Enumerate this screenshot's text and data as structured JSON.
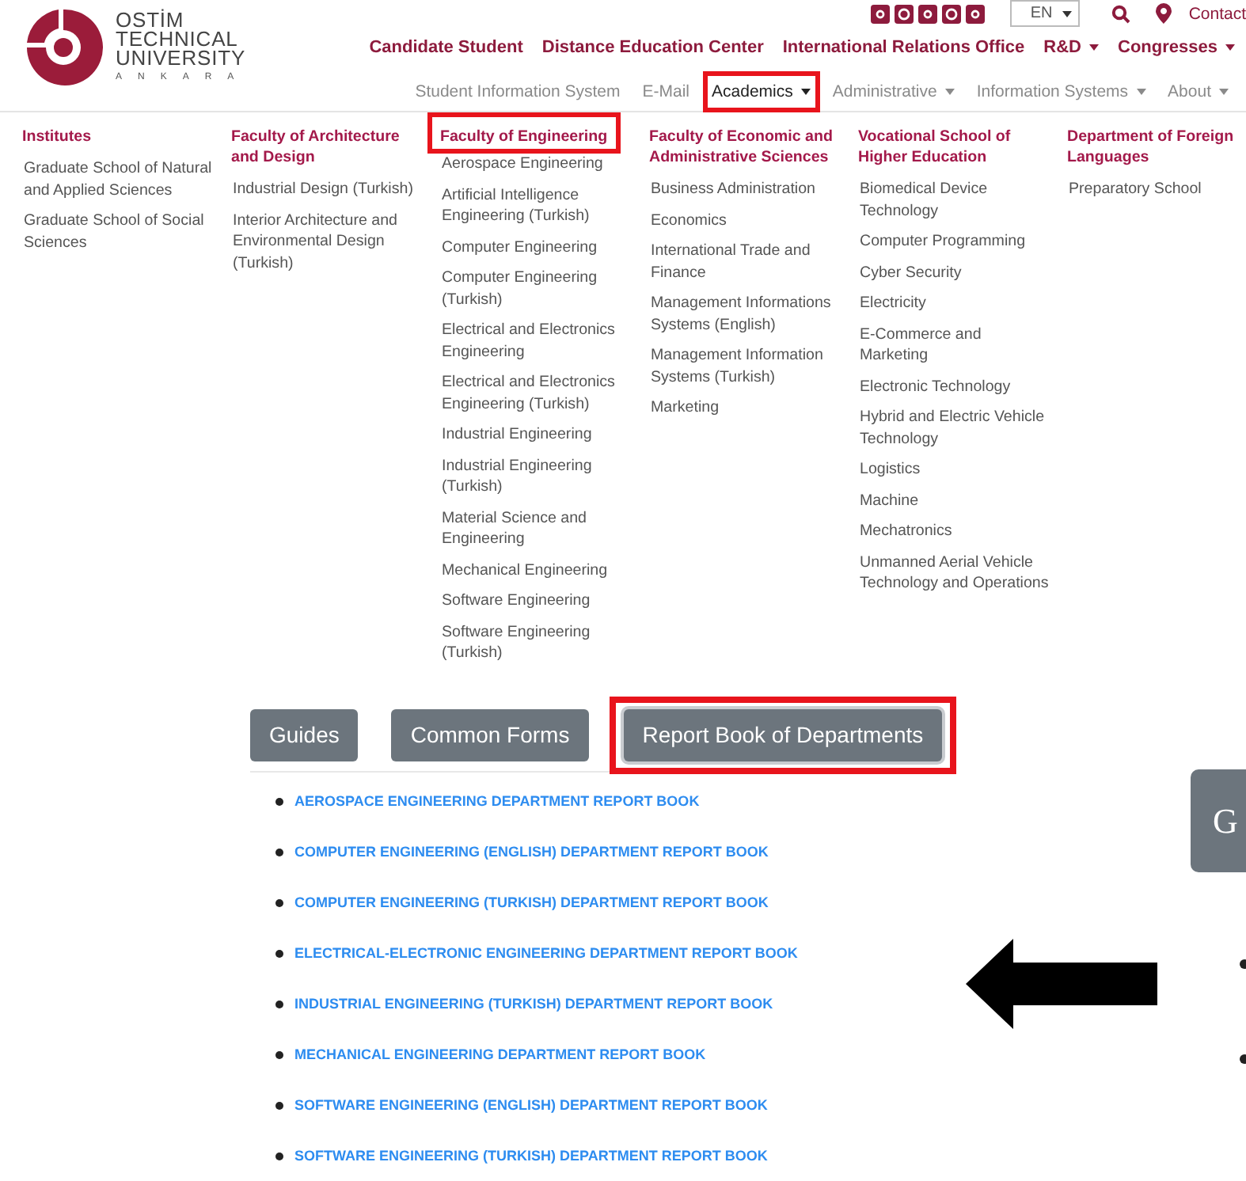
{
  "logo": {
    "name_lines": [
      "OSTİM",
      "TECHNICAL",
      "UNIVERSITY"
    ],
    "city": "ANKARA"
  },
  "top_bar": {
    "language": "EN",
    "contact": "Contact"
  },
  "main_nav": [
    {
      "label": "Candidate Student",
      "dropdown": false
    },
    {
      "label": "Distance Education Center",
      "dropdown": false
    },
    {
      "label": "International Relations Office",
      "dropdown": false
    },
    {
      "label": "R&D",
      "dropdown": true
    },
    {
      "label": "Congresses",
      "dropdown": true
    }
  ],
  "secondary_nav": [
    {
      "label": "Student Information System",
      "dropdown": false,
      "selected": false,
      "highlighted": false
    },
    {
      "label": "E-Mail",
      "dropdown": false,
      "selected": false,
      "highlighted": false
    },
    {
      "label": "Academics",
      "dropdown": true,
      "selected": true,
      "highlighted": true
    },
    {
      "label": "Administrative",
      "dropdown": true,
      "selected": false,
      "highlighted": false
    },
    {
      "label": "Information Systems",
      "dropdown": true,
      "selected": false,
      "highlighted": false
    },
    {
      "label": "About",
      "dropdown": true,
      "selected": false,
      "highlighted": false
    }
  ],
  "mega_menu": [
    {
      "title": "Institutes",
      "highlighted": false,
      "items": [
        "Graduate School of Natural and Applied Sciences",
        "Graduate School of Social Sciences"
      ]
    },
    {
      "title": "Faculty of Architecture and Design",
      "highlighted": false,
      "items": [
        "Industrial Design (Turkish)",
        "Interior Architecture and Environmental Design (Turkish)"
      ]
    },
    {
      "title": "Faculty of Engineering",
      "highlighted": true,
      "items": [
        "Aerospace Engineering",
        "Artificial Intelligence Engineering (Turkish)",
        "Computer Engineering",
        "Computer Engineering (Turkish)",
        "Electrical and Electronics Engineering",
        "Electrical and Electronics Engineering (Turkish)",
        "Industrial Engineering",
        "Industrial Engineering (Turkish)",
        "Material Science and Engineering",
        "Mechanical Engineering",
        "Software Engineering",
        "Software Engineering (Turkish)"
      ]
    },
    {
      "title": "Faculty of Economic and Administrative Sciences",
      "highlighted": false,
      "items": [
        "Business Administration",
        "Economics",
        "International Trade and Finance",
        "Management Informations Systems (English)",
        "Management Information Systems (Turkish)",
        "Marketing"
      ]
    },
    {
      "title": "Vocational School of Higher Education",
      "highlighted": false,
      "items": [
        "Biomedical Device Technology",
        "Computer Programming",
        "Cyber Security",
        "Electricity",
        "E-Commerce and Marketing",
        "Electronic Technology",
        "Hybrid and Electric Vehicle Technology",
        "Logistics",
        "Machine",
        "Mechatronics",
        "Unmanned Aerial Vehicle Technology and Operations"
      ]
    },
    {
      "title": "Department of Foreign Languages",
      "highlighted": false,
      "items": [
        "Preparatory School"
      ]
    }
  ],
  "tabs": [
    {
      "label": "Guides",
      "selected": false,
      "highlighted": false
    },
    {
      "label": "Common Forms",
      "selected": false,
      "highlighted": false
    },
    {
      "label": "Report Book of Departments",
      "selected": true,
      "highlighted": true
    }
  ],
  "report_books": [
    "AEROSPACE ENGINEERING DEPARTMENT REPORT BOOK",
    "COMPUTER ENGINEERING (ENGLISH) DEPARTMENT REPORT BOOK",
    "COMPUTER ENGINEERING (TURKISH) DEPARTMENT REPORT BOOK",
    "ELECTRICAL-ELECTRONIC ENGINEERING DEPARTMENT REPORT BOOK",
    "INDUSTRIAL ENGINEERING (TURKISH) DEPARTMENT REPORT BOOK",
    "MECHANICAL ENGINEERING DEPARTMENT REPORT BOOK",
    "SOFTWARE ENGINEERING (ENGLISH) DEPARTMENT REPORT BOOK",
    "SOFTWARE ENGINEERING (TURKISH) DEPARTMENT REPORT BOOK"
  ],
  "side_panel": {
    "button": "G"
  }
}
